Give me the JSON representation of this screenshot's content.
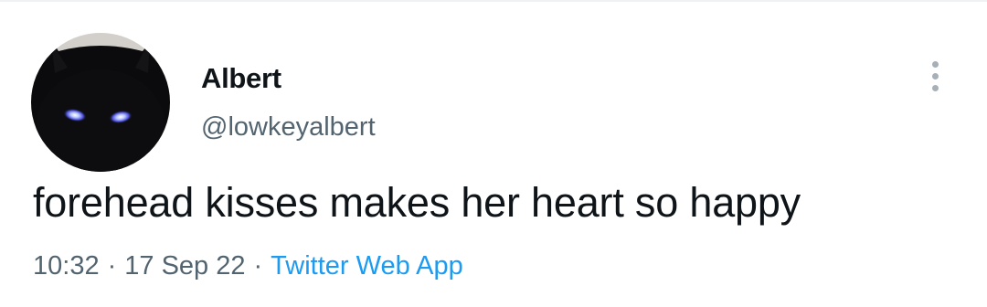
{
  "tweet": {
    "author": {
      "display_name": "Albert",
      "handle": "@lowkeyalbert",
      "avatar_description_icon": "avatar-black-cat"
    },
    "text": "forehead kisses makes her heart so happy",
    "meta": {
      "time": "10:32",
      "separator": "·",
      "date": "17 Sep 22",
      "source": "Twitter Web App"
    },
    "more_icon": "more-vertical-icon"
  },
  "colors": {
    "text_primary": "#0f1419",
    "text_secondary": "#536471",
    "link": "#1d9bf0",
    "more_dots": "#a7b0b7"
  }
}
